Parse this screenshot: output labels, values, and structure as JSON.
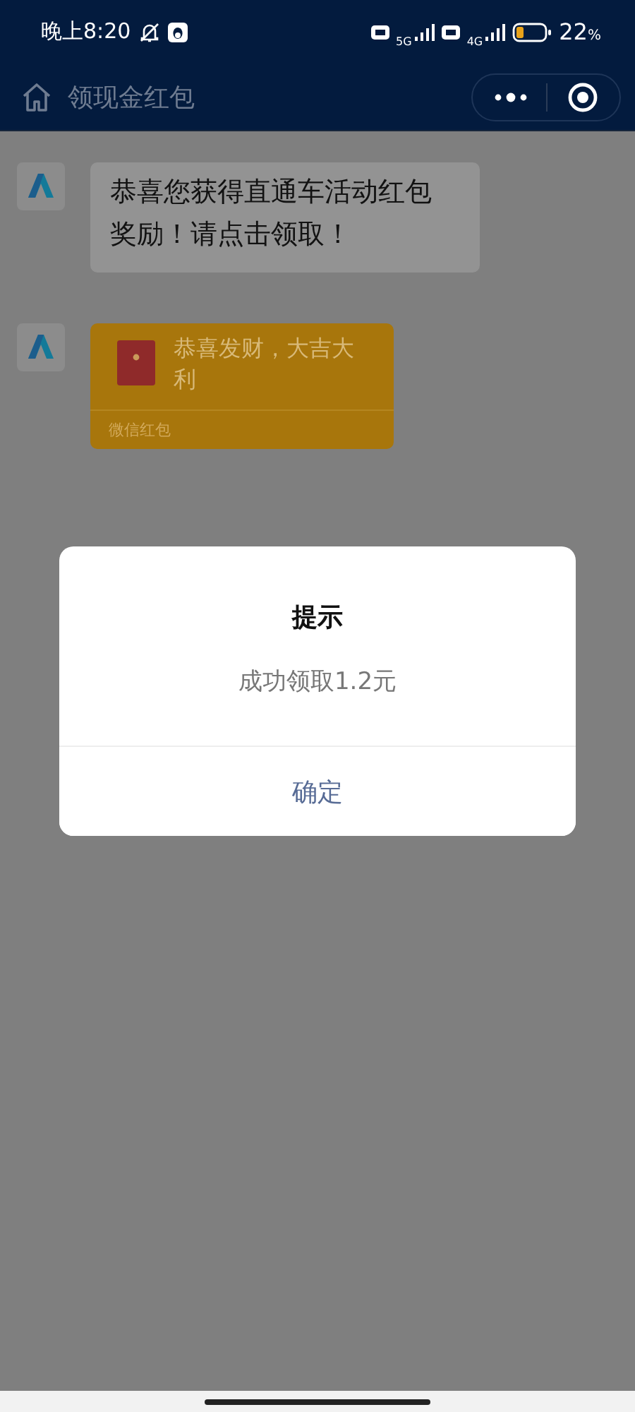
{
  "status_bar": {
    "time": "晚上8:20",
    "network_1": "5G",
    "network_2": "4G",
    "battery": "22",
    "battery_unit": "%"
  },
  "nav_bar": {
    "title": "领现金红包"
  },
  "messages": [
    {
      "kind": "text",
      "text": "恭喜您获得直通车活动红包奖励！请点击领取！"
    },
    {
      "kind": "red_packet",
      "text": "恭喜发财，大吉大利",
      "label": "微信红包"
    }
  ],
  "dialog": {
    "title": "提示",
    "message": "成功领取1.2元",
    "button": "确定"
  }
}
